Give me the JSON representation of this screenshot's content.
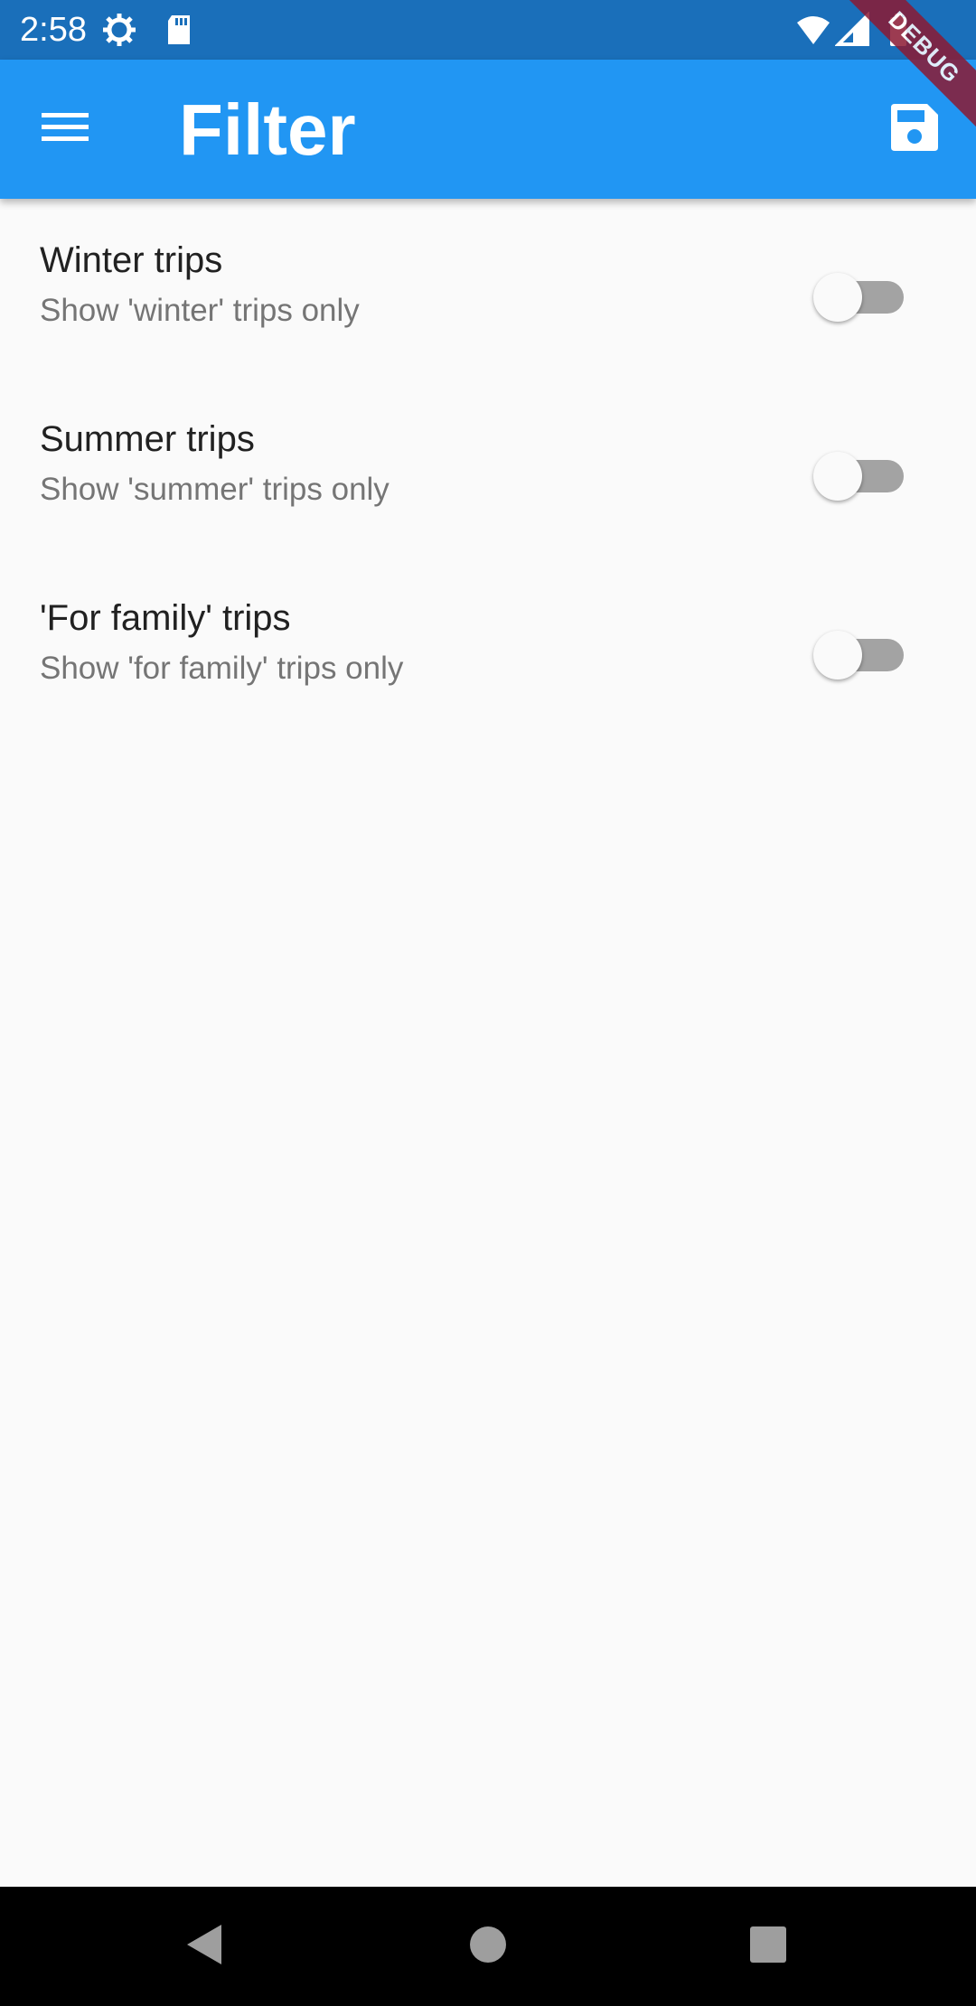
{
  "status_bar": {
    "time": "2:58",
    "icons": [
      "settings-gear-icon",
      "sd-card-icon",
      "wifi-icon",
      "signal-icon",
      "battery-icon"
    ]
  },
  "app_bar": {
    "title": "Filter",
    "menu_icon": "menu-icon",
    "save_icon": "save-icon",
    "background": "#2196f3"
  },
  "debug_banner": {
    "label": "DEBUG"
  },
  "filters": [
    {
      "title": "Winter trips",
      "subtitle": "Show 'winter' trips only",
      "enabled": false
    },
    {
      "title": "Summer trips",
      "subtitle": "Show 'summer' trips only",
      "enabled": false
    },
    {
      "title": "'For family' trips",
      "subtitle": "Show 'for family' trips only",
      "enabled": false
    }
  ],
  "nav_bar": {
    "icons": [
      "back-icon",
      "home-icon",
      "recents-icon"
    ]
  }
}
